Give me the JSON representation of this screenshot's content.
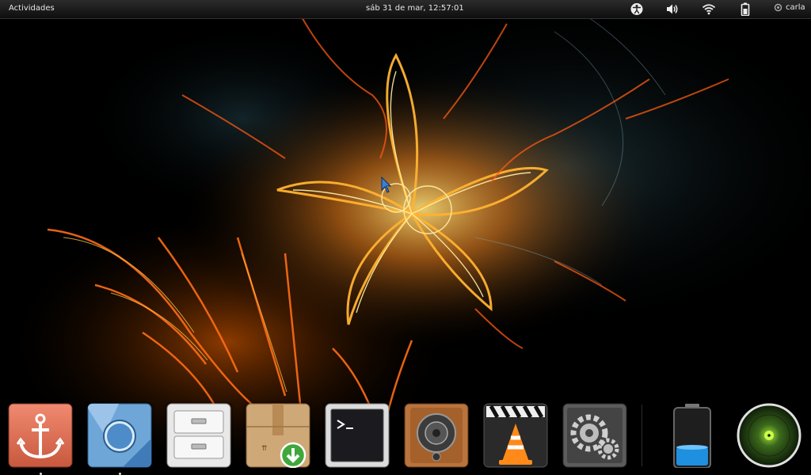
{
  "topbar": {
    "activities_label": "Actividades",
    "clock_text": "sáb 31 de mar, 12:57:01",
    "user_name": "carla",
    "tray_icons": [
      "accessibility-icon",
      "volume-icon",
      "wifi-icon",
      "battery-icon"
    ]
  },
  "dock": {
    "items": [
      {
        "name": "anchor-app"
      },
      {
        "name": "chromium-browser"
      },
      {
        "name": "file-cabinet"
      },
      {
        "name": "package-installer"
      },
      {
        "name": "terminal"
      },
      {
        "name": "speaker-app"
      },
      {
        "name": "vlc-media-player"
      },
      {
        "name": "system-settings"
      }
    ],
    "widgets": [
      {
        "name": "battery-widget"
      },
      {
        "name": "radar-widget"
      }
    ]
  },
  "colors": {
    "topbar_bg": "#1a1a1a",
    "fire_orange": "#ff7a18",
    "fire_yellow": "#ffd84a",
    "smoke_blue": "#3c6a78"
  }
}
